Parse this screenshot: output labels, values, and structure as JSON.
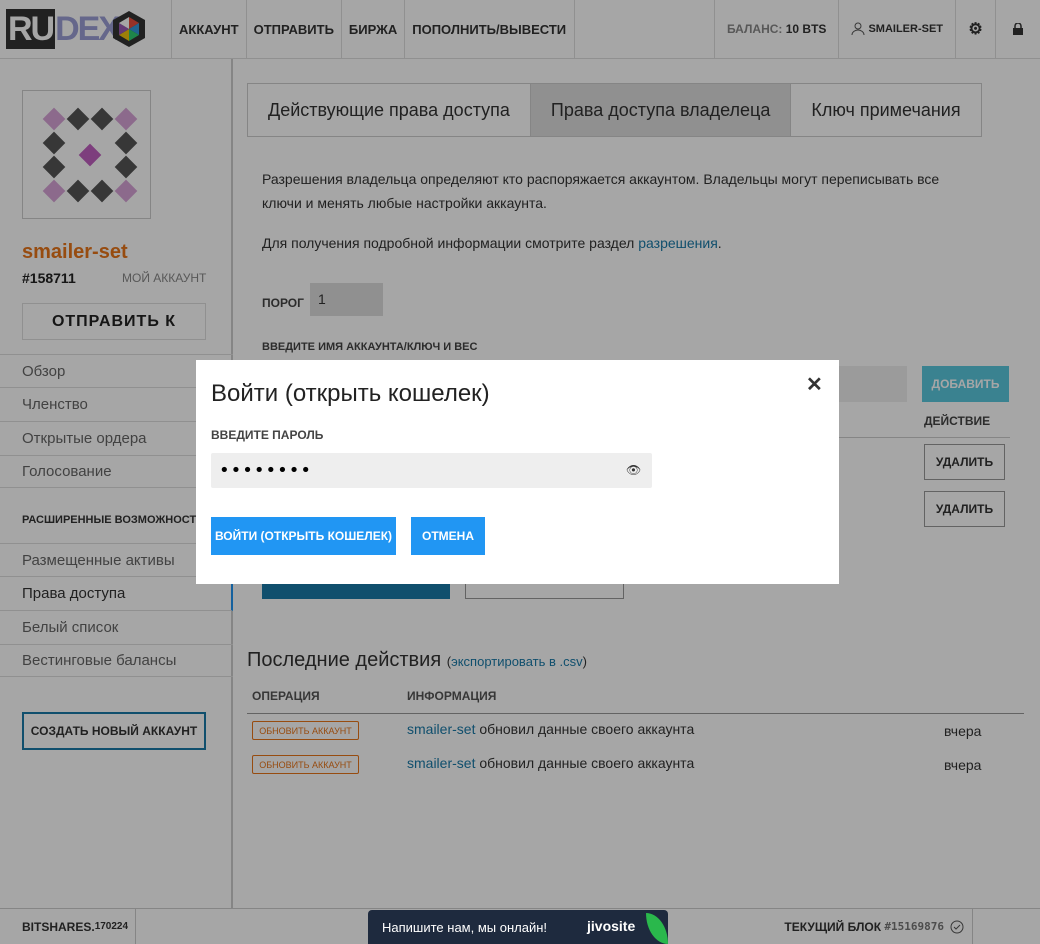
{
  "topbar": {
    "logo_text_ru": "RU",
    "logo_text_dex": "DEX",
    "nav": [
      "АККАУНТ",
      "ОТПРАВИТЬ",
      "БИРЖА",
      "ПОПОЛНИТЬ/ВЫВЕСТИ"
    ],
    "balance_label": "БАЛАНС:",
    "balance_value": "10 BTS",
    "user": "SMAILER-SET"
  },
  "sidebar": {
    "username": "smailer-set",
    "account_id": "#158711",
    "my_account": "МОЙ АККАУНТ",
    "send_button": "ОТПРАВИТЬ К",
    "menu1": [
      "Обзор",
      "Членство",
      "Открытые ордера",
      "Голосование"
    ],
    "advanced": "РАСШИРЕННЫЕ ВОЗМОЖНОСТИ ▼",
    "menu2": [
      "Размещенные активы",
      "Права доступа",
      "Белый список",
      "Вестинговые балансы"
    ],
    "create_account": "СОЗДАТЬ НОВЫЙ АККАУНТ"
  },
  "main": {
    "tabs": [
      "Действующие права доступа",
      "Права доступа владелеца",
      "Ключ примечания"
    ],
    "desc1_line1": "Разрешения владельца определяют кто распоряжается аккаунтом. Владельцы могут переписывать все",
    "desc1_line2": "ключи и менять любые настройки аккаунта.",
    "desc2_prefix": "Для получения подробной информации смотрите раздел",
    "desc2_link": "разрешения",
    "threshold_label": "ПОРОГ",
    "threshold_value": "1",
    "add_label": "ВВЕДИТЕ ИМЯ АККАУНТА/КЛЮЧ И ВЕС",
    "add_button": "ДОБАВИТЬ",
    "action_header": "ДЕЙСТВИЕ",
    "delete_button": "УДАЛИТЬ"
  },
  "history": {
    "title": "Последние действия",
    "export_link": "экспортировать в .csv",
    "col_op": "ОПЕРАЦИЯ",
    "col_info": "ИНФОРМАЦИЯ",
    "rows": [
      {
        "badge": "ОБНОВИТЬ АККАУНТ",
        "user": "smailer-set",
        "text": "обновил данные своего аккаунта",
        "date": "вчера"
      },
      {
        "badge": "ОБНОВИТЬ АККАУНТ",
        "user": "smailer-set",
        "text": "обновил данные своего аккаунта",
        "date": "вчера"
      }
    ]
  },
  "footer": {
    "version_label": "BITSHARES.",
    "version_num": "170224",
    "block_label": "ТЕКУЩИЙ БЛОК",
    "block_num": "#15169876"
  },
  "modal": {
    "title": "Войти (открыть кошелек)",
    "password_label": "ВВЕДИТЕ ПАРОЛЬ",
    "password_value": "••••••••",
    "login_button": "ВОЙТИ (ОТКРЫТЬ КОШЕЛЕК)",
    "cancel_button": "ОТМЕНА"
  },
  "chat": {
    "text": "Напишите нам, мы онлайн!",
    "brand": "jivosite"
  }
}
